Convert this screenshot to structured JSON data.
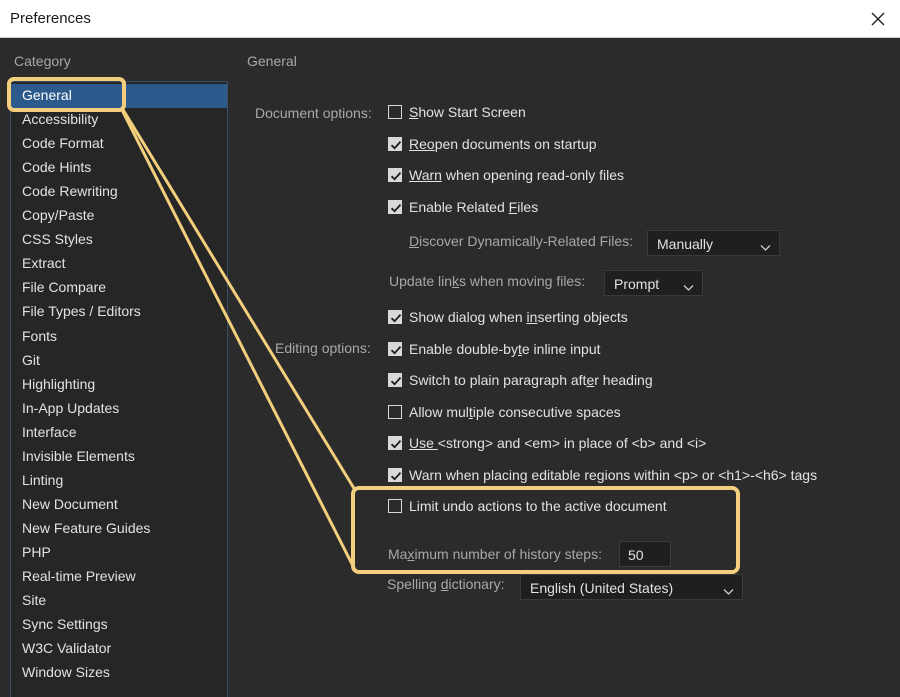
{
  "window": {
    "title": "Preferences"
  },
  "headers": {
    "category": "Category",
    "section": "General"
  },
  "categories": [
    "General",
    "Accessibility",
    "Code Format",
    "Code Hints",
    "Code Rewriting",
    "Copy/Paste",
    "CSS Styles",
    "Extract",
    "File Compare",
    "File Types / Editors",
    "Fonts",
    "Git",
    "Highlighting",
    "In-App Updates",
    "Interface",
    "Invisible Elements",
    "Linting",
    "New Document",
    "New Feature Guides",
    "PHP",
    "Real-time Preview",
    "Site",
    "Sync Settings",
    "W3C Validator",
    "Window Sizes"
  ],
  "selected_category": "General",
  "document_options": {
    "label": "Document options:",
    "show_start_screen": {
      "pre": "",
      "u": "S",
      "post": "how Start Screen",
      "checked": false
    },
    "reopen_documents": {
      "pre": "",
      "u": "Reo",
      "post": "pen documents on startup",
      "checked": true
    },
    "warn_readonly": {
      "pre": "",
      "u": "Warn",
      "post": " when opening read-only files",
      "checked": true
    },
    "enable_related_files": {
      "pre": "Enable Related ",
      "u": "F",
      "post": "iles",
      "checked": true
    },
    "discover_label": {
      "pre": "",
      "u": "D",
      "post": "iscover Dynamically-Related Files:"
    },
    "discover_value": "Manually",
    "update_links_label": {
      "pre": "Update lin",
      "u": "k",
      "post": "s when moving files:"
    },
    "update_links_value": "Prompt"
  },
  "editing_options": {
    "label": "Editing options:",
    "show_dialog": {
      "pre": "Show dialog when ",
      "u": "in",
      "post": "serting objects",
      "checked": true
    },
    "double_byte": {
      "pre": "Enable double-by",
      "u": "t",
      "post": "e inline input",
      "checked": true
    },
    "plain_paragraph": {
      "pre": "Switch to plain paragraph aft",
      "u": "e",
      "post": "r heading",
      "checked": true
    },
    "multiple_spaces": {
      "pre": "Allow mul",
      "u": "t",
      "post": "iple consecutive spaces",
      "checked": false
    },
    "use_strong": {
      "pre": "",
      "u": "Use ",
      "post": " <strong> and <em> in place of <b> and <i>",
      "checked": true
    },
    "warn_editable": {
      "pre": "Warn when placing editable regions within <p> or <h1>-<h6> tags",
      "u": "",
      "post": "",
      "checked": true
    },
    "limit_undo": {
      "pre": "Limit undo actions to the active document",
      "u": "",
      "post": "",
      "checked": false
    },
    "history_label": {
      "pre": "Ma",
      "u": "x",
      "post": "imum number of history steps:"
    },
    "history_value": "50",
    "spelling_label": {
      "pre": "Spelling ",
      "u": "d",
      "post": "ictionary:"
    },
    "spelling_value": "English (United States)"
  },
  "colors": {
    "highlight": "#f3cf7d",
    "selection": "#2d5a8c",
    "background": "#2b2b2b"
  },
  "icons": {
    "close": "close-icon",
    "chevron": "chevron-down-icon",
    "check": "checkmark-icon"
  }
}
